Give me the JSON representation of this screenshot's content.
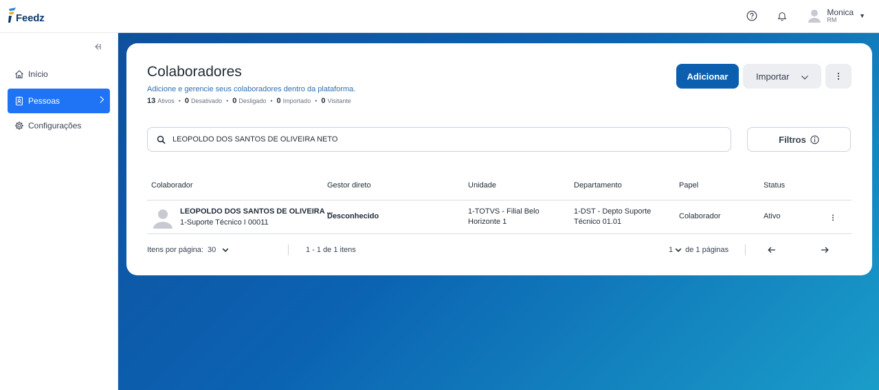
{
  "app": {
    "logo_text": "Feedz"
  },
  "header": {
    "user_name": "Monica",
    "user_sub": "RM",
    "icons": [
      "help-icon",
      "bell-icon",
      "avatar",
      "caret-down-icon"
    ]
  },
  "sidebar": {
    "items": [
      {
        "label": "Início",
        "icon": "home-icon",
        "active": false
      },
      {
        "label": "Pessoas",
        "icon": "id-badge-icon",
        "active": true
      },
      {
        "label": "Configurações",
        "icon": "gear-icon",
        "active": false
      }
    ]
  },
  "page": {
    "title": "Colaboradores",
    "subtitle": "Adicione e gerencie seus colaboradores dentro da plataforma.",
    "counts": [
      {
        "value": "13",
        "label": "Ativos"
      },
      {
        "value": "0",
        "label": "Desativado"
      },
      {
        "value": "0",
        "label": "Desligado"
      },
      {
        "value": "0",
        "label": "Importado"
      },
      {
        "value": "0",
        "label": "Visitante"
      }
    ],
    "add_label": "Adicionar",
    "import_label": "Importar",
    "filter_label": "Filtros"
  },
  "search": {
    "value": "LEOPOLDO DOS SANTOS DE OLIVEIRA NETO",
    "placeholder": ""
  },
  "table": {
    "headers": [
      "Colaborador",
      "Gestor direto",
      "Unidade",
      "Departamento",
      "Papel",
      "Status"
    ],
    "rows": [
      {
        "name": "LEOPOLDO DOS SANTOS DE OLIVEIRA ...",
        "role": "1-Suporte Técnico I 00011",
        "manager": "Desconhecido",
        "unit_line1": "1-TOTVS - Filial Belo",
        "unit_line2": "Horizonte 1",
        "dept_line1": "1-DST - Depto Suporte",
        "dept_line2": "Técnico 01.01",
        "papel": "Colaborador",
        "status": "Ativo"
      }
    ]
  },
  "pagination": {
    "per_page_label": "Itens por página:",
    "per_page_value": "30",
    "range": "1 - 1 de 1 itens",
    "current_page": "1",
    "pages_label": "de 1 páginas"
  },
  "colors": {
    "primary": "#0b5fae",
    "sidebar_active": "#1f74f5",
    "subtitle": "#2c6fb3"
  }
}
